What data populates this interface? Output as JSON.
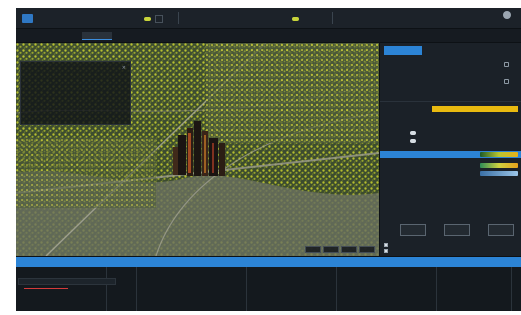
{
  "app": {
    "title": "",
    "toolbar": [
      {
        "label": "",
        "icon": "toggle-icon"
      },
      {
        "label": "",
        "icon": "layer-icon"
      },
      {
        "label": "",
        "icon": "measure-icon"
      },
      {
        "label": "",
        "icon": "draw-icon"
      },
      {
        "label": "",
        "icon": "analysis-icon"
      }
    ],
    "user_label": ""
  },
  "tabs": [
    {
      "label": ""
    },
    {
      "label": ""
    },
    {
      "label": "",
      "active": true
    },
    {
      "label": ""
    }
  ],
  "info_panel": {
    "title": "",
    "rows": [
      {
        "key": "",
        "value": ""
      },
      {
        "key": "",
        "value": ""
      },
      {
        "key": "",
        "value": ""
      },
      {
        "key": "",
        "value": ""
      },
      {
        "key": "",
        "value": ""
      },
      {
        "key": "",
        "value": ""
      },
      {
        "key": "",
        "value": ""
      }
    ]
  },
  "map": {
    "footer": "",
    "zoom_controls": [
      "",
      "",
      "",
      ""
    ]
  },
  "right_panel": {
    "tabs": [
      "",
      "",
      ""
    ],
    "active_tab": 0,
    "settings": [
      {
        "label": "",
        "value": ""
      },
      {
        "label": "",
        "value": ""
      }
    ],
    "layer": {
      "title": "",
      "selected": "",
      "props": [
        {
          "label": "",
          "value": ""
        },
        {
          "label": "",
          "value": ""
        },
        {
          "label": "",
          "value": ""
        },
        {
          "label": "",
          "value": ""
        }
      ],
      "highlight_row": "",
      "color_rows": [
        {
          "label": "",
          "gradient": "green-yellow"
        },
        {
          "label": "",
          "gradient": "green-gold"
        },
        {
          "label": "",
          "gradient": "blue"
        }
      ]
    },
    "buttons": [
      "",
      "",
      ""
    ],
    "checkboxes": [
      {
        "label": "",
        "checked": true
      },
      {
        "label": "",
        "checked": true
      }
    ]
  },
  "timeline": {
    "dates": [
      {
        "date": "",
        "sub": ""
      },
      {
        "date": "",
        "sub": ""
      }
    ],
    "marks": [
      "",
      "",
      "",
      "",
      "",
      "",
      "",
      "",
      "",
      "",
      "",
      "",
      "",
      "",
      "",
      "",
      "",
      "",
      "",
      "",
      ""
    ],
    "track_label": "",
    "items": [
      "",
      ""
    ]
  },
  "colors": {
    "accent": "#2c84d6",
    "highlight": "#e9ba10",
    "background": "#151a20",
    "vegetation": "#c8cf2a"
  }
}
